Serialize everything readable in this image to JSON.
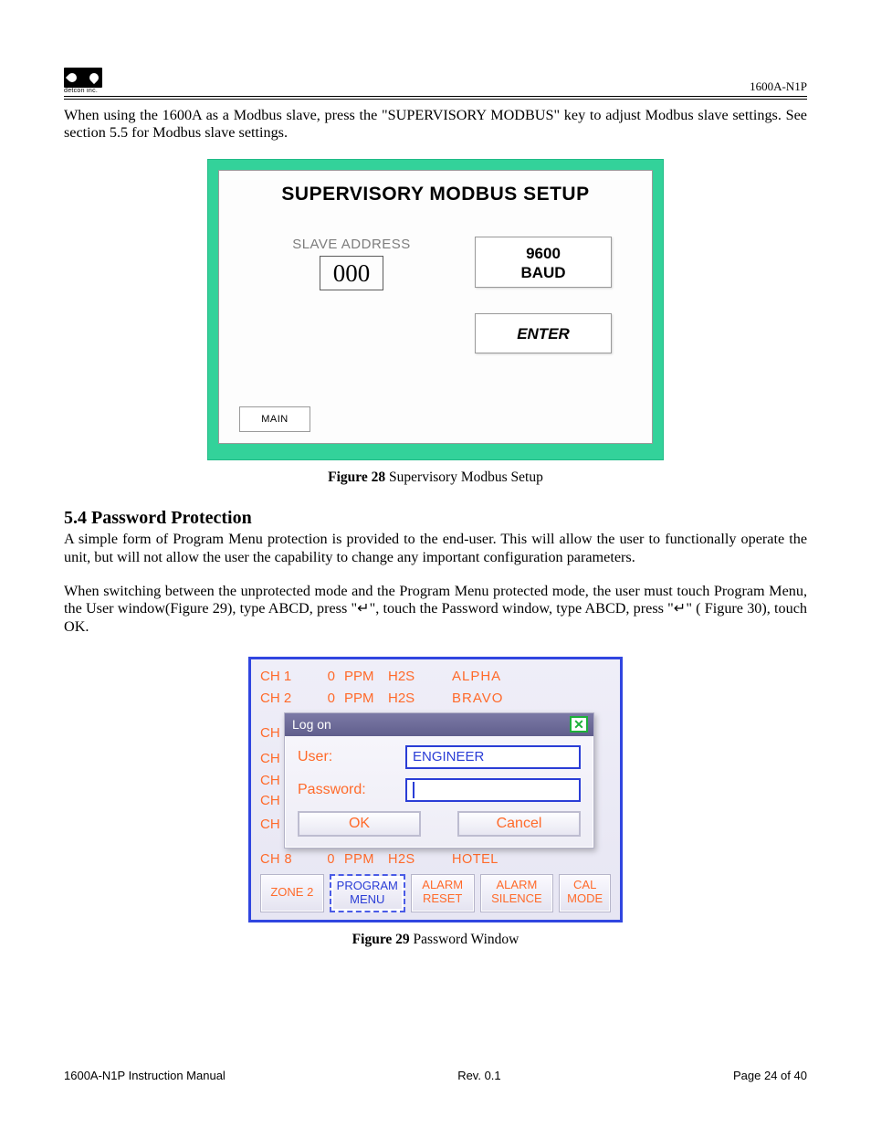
{
  "header": {
    "logo_sub": "detcon inc.",
    "doc_id": "1600A-N1P"
  },
  "para1": "When using the 1600A as a Modbus slave, press the \"SUPERVISORY MODBUS\" key to adjust Modbus slave settings.  See section 5.5 for Modbus slave settings.",
  "fig28": {
    "title": "SUPERVISORY MODBUS SETUP",
    "slave_label": "SLAVE ADDRESS",
    "slave_value": "000",
    "baud_line1": "9600",
    "baud_line2": "BAUD",
    "enter": "ENTER",
    "main": "MAIN",
    "caption_bold": "Figure 28",
    "caption_rest": " Supervisory Modbus Setup"
  },
  "section": {
    "heading": "5.4  Password Protection",
    "p1": "A simple form of Program Menu protection is provided to the end-user.  This will allow the user to functionally operate the unit, but will not allow the user the capability to change any important configuration parameters.",
    "p2": "When switching between the unprotected mode and the  Program Menu protected mode, the user must touch Program Menu, the User window(Figure 29), type ABCD, press \"↵\", touch the Password window, type ABCD, press \"↵\" ( Figure 30), touch OK."
  },
  "fig29": {
    "rows": [
      {
        "ch": "CH 1",
        "val": "0",
        "unit": "PPM",
        "gas": "H2S",
        "name": "ALPHA"
      },
      {
        "ch": "CH 2",
        "val": "0",
        "unit": "PPM",
        "gas": "H2S",
        "name": "BRAVO"
      }
    ],
    "side_ch": [
      "CH",
      "CH",
      "CH",
      "CH",
      "CH"
    ],
    "logon_title": "Log on",
    "user_label": "User:",
    "user_value": "ENGINEER",
    "pw_label": "Password:",
    "ok": "OK",
    "cancel": "Cancel",
    "below": {
      "ch": "CH 8",
      "val": "0",
      "unit": "PPM",
      "gas": "H2S",
      "name": "HOTEL"
    },
    "nav": {
      "zone": "ZONE 2",
      "prog1": "PROGRAM",
      "prog2": "MENU",
      "ar1": "ALARM",
      "ar2": "RESET",
      "as1": "ALARM",
      "as2": "SILENCE",
      "cal1": "CAL",
      "cal2": "MODE"
    },
    "caption_bold": "Figure 29",
    "caption_rest": " Password Window"
  },
  "footer": {
    "left": "1600A-N1P Instruction Manual",
    "center": "Rev. 0.1",
    "right": "Page 24 of 40"
  }
}
